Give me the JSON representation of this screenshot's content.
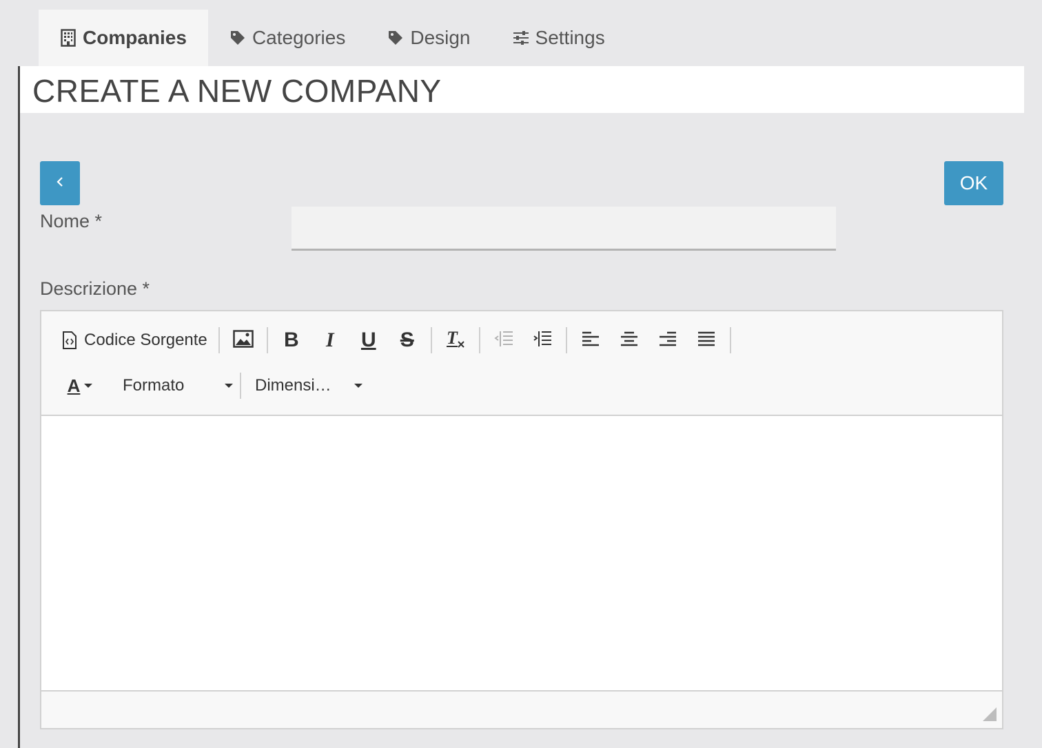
{
  "tabs": [
    {
      "label": "Companies",
      "icon": "building-icon",
      "active": true
    },
    {
      "label": "Categories",
      "icon": "tag-icon",
      "active": false
    },
    {
      "label": "Design",
      "icon": "tag-icon",
      "active": false
    },
    {
      "label": "Settings",
      "icon": "sliders-icon",
      "active": false
    }
  ],
  "page": {
    "title": "CREATE A NEW COMPANY"
  },
  "buttons": {
    "back_label": "‹",
    "ok_label": "OK"
  },
  "form": {
    "nome_label": "Nome *",
    "nome_value": "",
    "descrizione_label": "Descrizione *"
  },
  "editor": {
    "source_label": "Codice Sorgente",
    "format_label": "Formato",
    "size_label": "Dimensi…",
    "text_color_label": "A",
    "content": ""
  },
  "colors": {
    "accent": "#3e97c4",
    "background": "#e8e8ea"
  }
}
